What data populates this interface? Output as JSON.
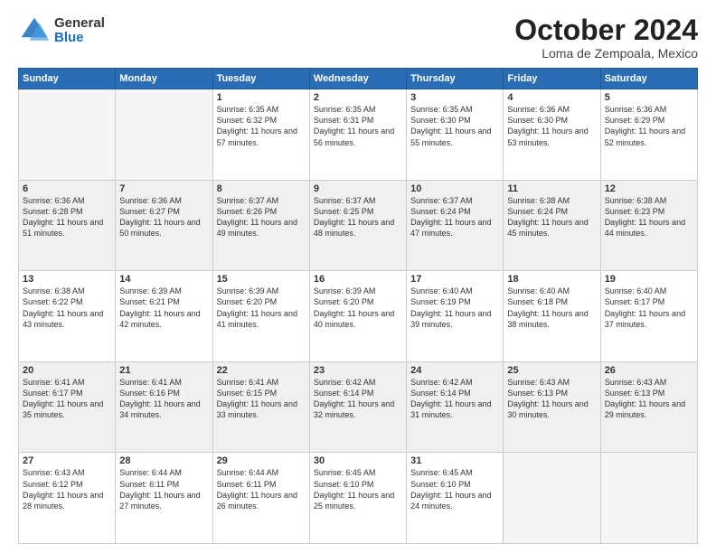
{
  "logo": {
    "general": "General",
    "blue": "Blue"
  },
  "title": "October 2024",
  "location": "Loma de Zempoala, Mexico",
  "days_of_week": [
    "Sunday",
    "Monday",
    "Tuesday",
    "Wednesday",
    "Thursday",
    "Friday",
    "Saturday"
  ],
  "weeks": [
    [
      {
        "day": "",
        "sunrise": "",
        "sunset": "",
        "daylight": "",
        "empty": true
      },
      {
        "day": "",
        "sunrise": "",
        "sunset": "",
        "daylight": "",
        "empty": true
      },
      {
        "day": "1",
        "sunrise": "Sunrise: 6:35 AM",
        "sunset": "Sunset: 6:32 PM",
        "daylight": "Daylight: 11 hours and 57 minutes."
      },
      {
        "day": "2",
        "sunrise": "Sunrise: 6:35 AM",
        "sunset": "Sunset: 6:31 PM",
        "daylight": "Daylight: 11 hours and 56 minutes."
      },
      {
        "day": "3",
        "sunrise": "Sunrise: 6:35 AM",
        "sunset": "Sunset: 6:30 PM",
        "daylight": "Daylight: 11 hours and 55 minutes."
      },
      {
        "day": "4",
        "sunrise": "Sunrise: 6:36 AM",
        "sunset": "Sunset: 6:30 PM",
        "daylight": "Daylight: 11 hours and 53 minutes."
      },
      {
        "day": "5",
        "sunrise": "Sunrise: 6:36 AM",
        "sunset": "Sunset: 6:29 PM",
        "daylight": "Daylight: 11 hours and 52 minutes."
      }
    ],
    [
      {
        "day": "6",
        "sunrise": "Sunrise: 6:36 AM",
        "sunset": "Sunset: 6:28 PM",
        "daylight": "Daylight: 11 hours and 51 minutes."
      },
      {
        "day": "7",
        "sunrise": "Sunrise: 6:36 AM",
        "sunset": "Sunset: 6:27 PM",
        "daylight": "Daylight: 11 hours and 50 minutes."
      },
      {
        "day": "8",
        "sunrise": "Sunrise: 6:37 AM",
        "sunset": "Sunset: 6:26 PM",
        "daylight": "Daylight: 11 hours and 49 minutes."
      },
      {
        "day": "9",
        "sunrise": "Sunrise: 6:37 AM",
        "sunset": "Sunset: 6:25 PM",
        "daylight": "Daylight: 11 hours and 48 minutes."
      },
      {
        "day": "10",
        "sunrise": "Sunrise: 6:37 AM",
        "sunset": "Sunset: 6:24 PM",
        "daylight": "Daylight: 11 hours and 47 minutes."
      },
      {
        "day": "11",
        "sunrise": "Sunrise: 6:38 AM",
        "sunset": "Sunset: 6:24 PM",
        "daylight": "Daylight: 11 hours and 45 minutes."
      },
      {
        "day": "12",
        "sunrise": "Sunrise: 6:38 AM",
        "sunset": "Sunset: 6:23 PM",
        "daylight": "Daylight: 11 hours and 44 minutes."
      }
    ],
    [
      {
        "day": "13",
        "sunrise": "Sunrise: 6:38 AM",
        "sunset": "Sunset: 6:22 PM",
        "daylight": "Daylight: 11 hours and 43 minutes."
      },
      {
        "day": "14",
        "sunrise": "Sunrise: 6:39 AM",
        "sunset": "Sunset: 6:21 PM",
        "daylight": "Daylight: 11 hours and 42 minutes."
      },
      {
        "day": "15",
        "sunrise": "Sunrise: 6:39 AM",
        "sunset": "Sunset: 6:20 PM",
        "daylight": "Daylight: 11 hours and 41 minutes."
      },
      {
        "day": "16",
        "sunrise": "Sunrise: 6:39 AM",
        "sunset": "Sunset: 6:20 PM",
        "daylight": "Daylight: 11 hours and 40 minutes."
      },
      {
        "day": "17",
        "sunrise": "Sunrise: 6:40 AM",
        "sunset": "Sunset: 6:19 PM",
        "daylight": "Daylight: 11 hours and 39 minutes."
      },
      {
        "day": "18",
        "sunrise": "Sunrise: 6:40 AM",
        "sunset": "Sunset: 6:18 PM",
        "daylight": "Daylight: 11 hours and 38 minutes."
      },
      {
        "day": "19",
        "sunrise": "Sunrise: 6:40 AM",
        "sunset": "Sunset: 6:17 PM",
        "daylight": "Daylight: 11 hours and 37 minutes."
      }
    ],
    [
      {
        "day": "20",
        "sunrise": "Sunrise: 6:41 AM",
        "sunset": "Sunset: 6:17 PM",
        "daylight": "Daylight: 11 hours and 35 minutes."
      },
      {
        "day": "21",
        "sunrise": "Sunrise: 6:41 AM",
        "sunset": "Sunset: 6:16 PM",
        "daylight": "Daylight: 11 hours and 34 minutes."
      },
      {
        "day": "22",
        "sunrise": "Sunrise: 6:41 AM",
        "sunset": "Sunset: 6:15 PM",
        "daylight": "Daylight: 11 hours and 33 minutes."
      },
      {
        "day": "23",
        "sunrise": "Sunrise: 6:42 AM",
        "sunset": "Sunset: 6:14 PM",
        "daylight": "Daylight: 11 hours and 32 minutes."
      },
      {
        "day": "24",
        "sunrise": "Sunrise: 6:42 AM",
        "sunset": "Sunset: 6:14 PM",
        "daylight": "Daylight: 11 hours and 31 minutes."
      },
      {
        "day": "25",
        "sunrise": "Sunrise: 6:43 AM",
        "sunset": "Sunset: 6:13 PM",
        "daylight": "Daylight: 11 hours and 30 minutes."
      },
      {
        "day": "26",
        "sunrise": "Sunrise: 6:43 AM",
        "sunset": "Sunset: 6:13 PM",
        "daylight": "Daylight: 11 hours and 29 minutes."
      }
    ],
    [
      {
        "day": "27",
        "sunrise": "Sunrise: 6:43 AM",
        "sunset": "Sunset: 6:12 PM",
        "daylight": "Daylight: 11 hours and 28 minutes."
      },
      {
        "day": "28",
        "sunrise": "Sunrise: 6:44 AM",
        "sunset": "Sunset: 6:11 PM",
        "daylight": "Daylight: 11 hours and 27 minutes."
      },
      {
        "day": "29",
        "sunrise": "Sunrise: 6:44 AM",
        "sunset": "Sunset: 6:11 PM",
        "daylight": "Daylight: 11 hours and 26 minutes."
      },
      {
        "day": "30",
        "sunrise": "Sunrise: 6:45 AM",
        "sunset": "Sunset: 6:10 PM",
        "daylight": "Daylight: 11 hours and 25 minutes."
      },
      {
        "day": "31",
        "sunrise": "Sunrise: 6:45 AM",
        "sunset": "Sunset: 6:10 PM",
        "daylight": "Daylight: 11 hours and 24 minutes."
      },
      {
        "day": "",
        "sunrise": "",
        "sunset": "",
        "daylight": "",
        "empty": true
      },
      {
        "day": "",
        "sunrise": "",
        "sunset": "",
        "daylight": "",
        "empty": true
      }
    ]
  ]
}
